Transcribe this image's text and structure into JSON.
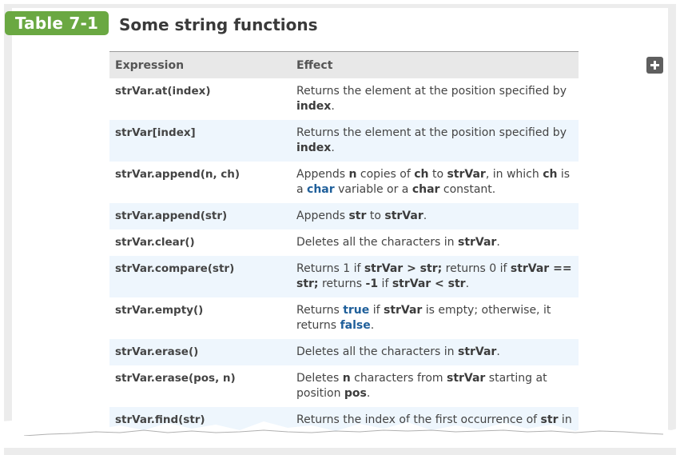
{
  "header": {
    "badge": "Table 7-1",
    "title": "Some string functions"
  },
  "colors": {
    "badge_green": "#6aa842",
    "keyword_blue": "#1f5f9a",
    "row_shade": "#eef6fd"
  },
  "table": {
    "columns": [
      "Expression",
      "Effect"
    ],
    "rows": [
      {
        "expression": "strVar.at(index)",
        "effect": [
          "Returns the element at the position specified by ",
          "index",
          "."
        ]
      },
      {
        "expression": "strVar[index]",
        "effect": [
          "Returns the element at the position specified by ",
          "index",
          "."
        ]
      },
      {
        "expression": "strVar.append(n, ch)",
        "effect": [
          "Appends ",
          "n",
          " copies of ",
          "ch",
          " to ",
          "strVar",
          ", in which ",
          "ch",
          " is a ",
          "char",
          " variable or a ",
          "char",
          " constant."
        ]
      },
      {
        "expression": "strVar.append(str)",
        "effect": [
          "Appends ",
          "str",
          " to ",
          "strVar",
          "."
        ]
      },
      {
        "expression": "strVar.clear()",
        "effect": [
          "Deletes all the characters in ",
          "strVar",
          "."
        ]
      },
      {
        "expression": "strVar.compare(str)",
        "effect": [
          "Returns ",
          "1",
          " if ",
          "strVar > str;",
          " returns ",
          "0",
          " if ",
          "strVar == str;",
          " returns ",
          "-1",
          " if ",
          "strVar < str",
          "."
        ]
      },
      {
        "expression": "strVar.empty()",
        "effect": [
          "Returns ",
          "true",
          " if ",
          "strVar",
          " is empty; otherwise, it returns ",
          "false",
          "."
        ]
      },
      {
        "expression": "strVar.erase()",
        "effect": [
          "Deletes all the characters in ",
          "strVar",
          "."
        ]
      },
      {
        "expression": "strVar.erase(pos, n)",
        "effect": [
          "Deletes ",
          "n",
          " characters from ",
          "strVar",
          " starting at position ",
          "pos",
          "."
        ]
      },
      {
        "expression": "strVar.find(str)",
        "effect": [
          "Returns the index of the first occurrence of ",
          "str",
          " in"
        ]
      }
    ]
  }
}
